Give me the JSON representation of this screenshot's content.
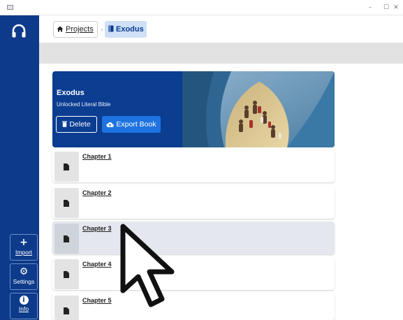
{
  "window": {
    "minimize_glyph": "–",
    "maximize_glyph": "☐",
    "close_glyph": "✕"
  },
  "sidebar": {
    "logo_icon": "headset-icon",
    "items": [
      {
        "glyph": "+",
        "label": "Import",
        "icon": "plus-icon"
      },
      {
        "glyph": "⚙",
        "label": "Settings",
        "icon": "gear-icon"
      },
      {
        "glyph": "i",
        "label": "Info",
        "icon": "info-icon"
      }
    ]
  },
  "breadcrumb": {
    "projects_label": "Projects",
    "separator": "›",
    "current_label": "Exodus"
  },
  "hero": {
    "title": "Exodus",
    "subtitle": "Unlocked Literal Bible",
    "delete_label": "Delete",
    "export_label": "Export Book"
  },
  "chapters": [
    {
      "label": "Chapter 1"
    },
    {
      "label": "Chapter 2"
    },
    {
      "label": "Chapter 3"
    },
    {
      "label": "Chapter 4"
    },
    {
      "label": "Chapter 5"
    }
  ],
  "colors": {
    "sidebar": "#0d3a8a",
    "accent": "#1e73e0",
    "breadcrumb_active": "#cfe0f7"
  }
}
